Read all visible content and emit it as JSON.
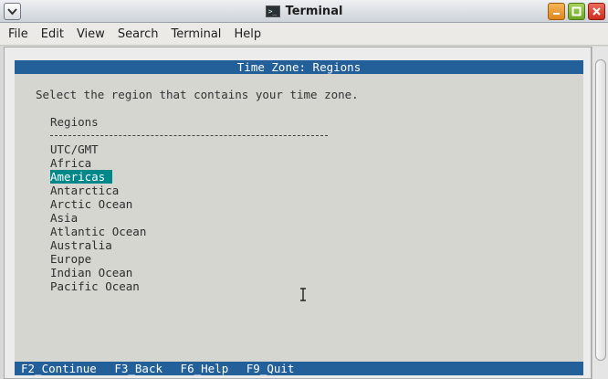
{
  "window": {
    "title": "Terminal",
    "icons": {
      "menu": "chevron-down-icon",
      "app": "terminal-icon",
      "minimize": "minimize-icon",
      "maximize": "maximize-icon",
      "close": "close-icon"
    }
  },
  "menubar": [
    "File",
    "Edit",
    "View",
    "Search",
    "Terminal",
    "Help"
  ],
  "terminal": {
    "header": "Time Zone: Regions",
    "prompt": "Select the region that contains your time zone.",
    "list_heading": "Regions",
    "regions": [
      "UTC/GMT",
      "Africa",
      "Americas",
      "Antarctica",
      "Arctic Ocean",
      "Asia",
      "Atlantic Ocean",
      "Australia",
      "Europe",
      "Indian Ocean",
      "Pacific Ocean"
    ],
    "selected_region": "Americas",
    "footer": [
      "F2_Continue",
      "F3_Back",
      "F6_Help",
      "F9_Quit"
    ]
  },
  "colors": {
    "header_bg": "#235f98",
    "selection_bg": "#00878a",
    "terminal_bg": "#d4d6cf"
  }
}
